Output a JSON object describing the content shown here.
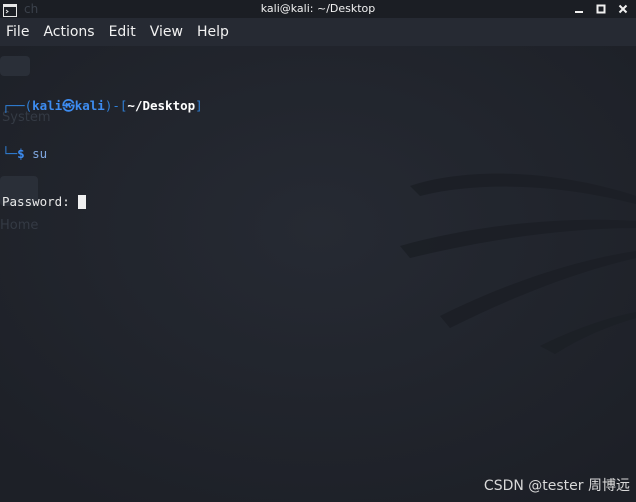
{
  "window": {
    "title": "kali@kali: ~/Desktop",
    "ghost_label": "ch"
  },
  "menu": {
    "items": [
      {
        "label": "File"
      },
      {
        "label": "Actions"
      },
      {
        "label": "Edit"
      },
      {
        "label": "View"
      },
      {
        "label": "Help"
      }
    ]
  },
  "desktop_ghosts": {
    "system": "System",
    "home": "Home"
  },
  "terminal": {
    "prompt_open": "┌──(",
    "user": "kali",
    "at_symbol": "㉿",
    "host": "kali",
    "prompt_mid": ")-[",
    "path": "~/Desktop",
    "prompt_close": "]",
    "prompt_second": "└─",
    "dollar": "$",
    "command": "su",
    "password_label": "Password:"
  },
  "watermark": "CSDN @tester 周博远",
  "icons": {
    "app": "terminal-app-icon",
    "minimize": "minimize-icon",
    "maximize": "maximize-icon",
    "close": "close-icon"
  },
  "colors": {
    "background": "#23272f",
    "menubar": "#262a33",
    "titlebar": "#1b1e24",
    "prompt_blue": "#2f7fd6",
    "user_blue": "#3d8cf0",
    "text_white": "#e8e8e8"
  }
}
